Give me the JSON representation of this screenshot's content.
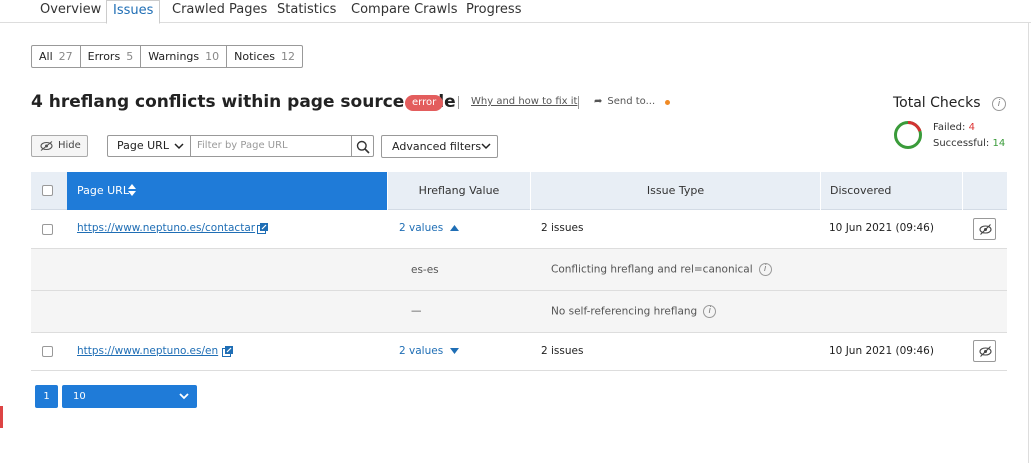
{
  "tabs": [
    {
      "label": "Overview"
    },
    {
      "label": "Issues"
    },
    {
      "label": "Crawled Pages"
    },
    {
      "label": "Statistics"
    },
    {
      "label": "Compare Crawls"
    },
    {
      "label": "Progress"
    }
  ],
  "filters": [
    {
      "label": "All",
      "count": "27"
    },
    {
      "label": "Errors",
      "count": "5"
    },
    {
      "label": "Warnings",
      "count": "10"
    },
    {
      "label": "Notices",
      "count": "12"
    }
  ],
  "issue": {
    "title": "4 hreflang conflicts within page source code",
    "badge": "error",
    "why_link": "Why and how to fix it",
    "send_to": "Send to..."
  },
  "total_checks": {
    "title": "Total Checks",
    "failed_label": "Failed:",
    "failed_value": "4",
    "successful_label": "Successful:",
    "successful_value": "14"
  },
  "controls": {
    "hide_label": "Hide",
    "column_select": "Page URL",
    "filter_placeholder": "Filter by Page URL",
    "advanced_filters": "Advanced filters"
  },
  "table": {
    "headers": {
      "page_url": "Page URL",
      "hreflang": "Hreflang Value",
      "issue_type": "Issue Type",
      "discovered": "Discovered"
    },
    "rows": [
      {
        "url": "https://www.neptuno.es/contactar",
        "hreflang": "2 values",
        "issue_type": "2 issues",
        "discovered": "10 Jun 2021 (09:46)",
        "expanded": true,
        "sub": [
          {
            "hreflang": "es-es",
            "issue": "Conflicting hreflang and rel=canonical"
          },
          {
            "hreflang": "—",
            "issue": "No self-referencing hreflang"
          }
        ]
      },
      {
        "url": "https://www.neptuno.es/en",
        "hreflang": "2 values",
        "issue_type": "2 issues",
        "discovered": "10 Jun 2021 (09:46)",
        "expanded": false
      }
    ]
  },
  "pagination": {
    "current_page": "1",
    "per_page": "10"
  },
  "colors": {
    "accent": "#1f7bd8",
    "error": "#e35d5d",
    "failed": "#d33333",
    "success": "#3a9b3a"
  }
}
